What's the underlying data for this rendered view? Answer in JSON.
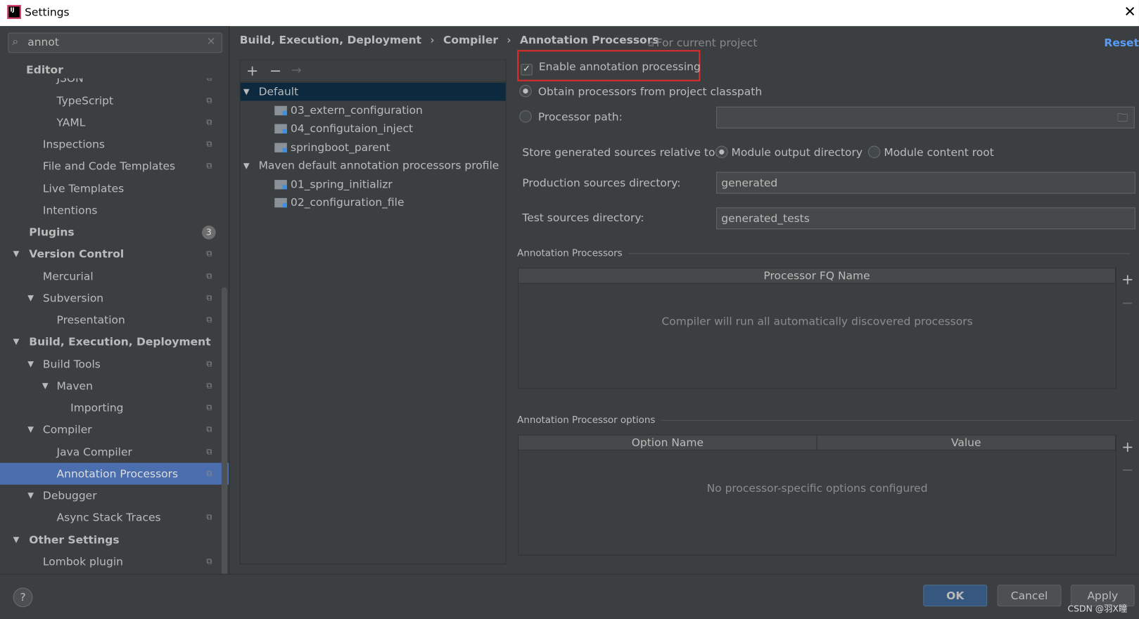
{
  "window": {
    "title": "Settings"
  },
  "search": {
    "value": "annot"
  },
  "sidebar": {
    "items": [
      {
        "label": "Editor"
      },
      {
        "label": "JSON"
      },
      {
        "label": "TypeScript"
      },
      {
        "label": "YAML"
      },
      {
        "label": "Inspections"
      },
      {
        "label": "File and Code Templates"
      },
      {
        "label": "Live Templates"
      },
      {
        "label": "Intentions"
      },
      {
        "label": "Plugins",
        "badge": "3"
      },
      {
        "label": "Version Control"
      },
      {
        "label": "Mercurial"
      },
      {
        "label": "Subversion"
      },
      {
        "label": "Presentation"
      },
      {
        "label": "Build, Execution, Deployment"
      },
      {
        "label": "Build Tools"
      },
      {
        "label": "Maven"
      },
      {
        "label": "Importing"
      },
      {
        "label": "Compiler"
      },
      {
        "label": "Java Compiler"
      },
      {
        "label": "Annotation Processors",
        "selected": true
      },
      {
        "label": "Debugger"
      },
      {
        "label": "Async Stack Traces"
      },
      {
        "label": "Other Settings"
      },
      {
        "label": "Lombok plugin"
      }
    ]
  },
  "breadcrumb": [
    "Build, Execution, Deployment",
    "Compiler",
    "Annotation Processors"
  ],
  "header": {
    "scope": "For current project",
    "reset": "Reset"
  },
  "profiles": [
    {
      "label": "Default",
      "selected": true,
      "children": [
        "03_extern_configuration",
        "04_configutaion_inject",
        "springboot_parent"
      ]
    },
    {
      "label": "Maven default annotation processors profile",
      "children": [
        "01_spring_initializr",
        "02_configuration_file"
      ]
    }
  ],
  "form": {
    "enable": {
      "label": "Enable annotation processing",
      "checked": true
    },
    "obtain": {
      "label": "Obtain processors from project classpath",
      "selected": true
    },
    "path": {
      "label": "Processor path:",
      "value": ""
    },
    "store": {
      "label": "Store generated sources relative to:",
      "opt1": "Module output directory",
      "opt2": "Module content root",
      "selected": "Module output directory"
    },
    "prod": {
      "label": "Production sources directory:",
      "value": "generated"
    },
    "test": {
      "label": "Test sources directory:",
      "value": "generated_tests"
    }
  },
  "processors": {
    "title": "Annotation Processors",
    "column": "Processor FQ Name",
    "empty": "Compiler will run all automatically discovered processors"
  },
  "options": {
    "title": "Annotation Processor options",
    "columns": [
      "Option Name",
      "Value"
    ],
    "empty": "No processor-specific options configured"
  },
  "buttons": {
    "ok": "OK",
    "cancel": "Cancel",
    "apply": "Apply",
    "help": "?"
  },
  "watermark": "CSDN @羽X瞳",
  "colors": {
    "selection": "#4b6eaf",
    "tree_selection": "#0d293e",
    "highlight_box": "#e02b2b",
    "link": "#589df6"
  }
}
